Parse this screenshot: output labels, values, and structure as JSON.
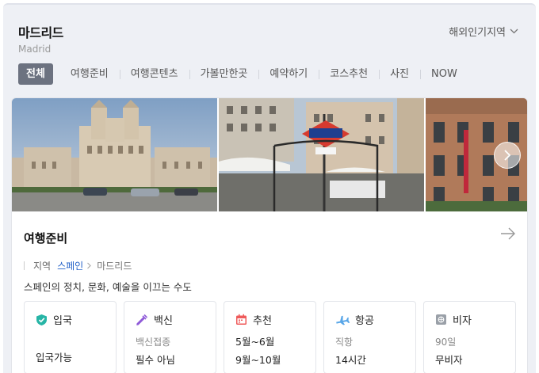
{
  "header": {
    "title": "마드리드",
    "subtitle": "Madrid",
    "region_label": "해외인기지역"
  },
  "tabs": [
    {
      "label": "전체",
      "active": true
    },
    {
      "label": "여행준비"
    },
    {
      "label": "여행콘텐츠"
    },
    {
      "label": "가볼만한곳"
    },
    {
      "label": "예약하기"
    },
    {
      "label": "코스추천"
    },
    {
      "label": "사진"
    },
    {
      "label": "NOW"
    }
  ],
  "section": {
    "title": "여행준비",
    "breadcrumb": {
      "label": "지역",
      "country": "스페인",
      "city": "마드리드"
    },
    "description": "스페인의 정치, 문화, 예술을 이끄는 수도"
  },
  "info_cards": {
    "entry": {
      "title": "입국",
      "line1": "",
      "line2": "입국가능",
      "icon": "shield-check-icon",
      "color": "#27b5a6"
    },
    "vaccine": {
      "title": "백신",
      "line1": "백신접종",
      "line2": "필수 아님",
      "icon": "syringe-icon",
      "color": "#8f5ad8"
    },
    "recommend": {
      "title": "추천",
      "line1": "5월~6월",
      "line2": "9월~10월",
      "icon": "calendar-icon",
      "color": "#ef5a5a"
    },
    "flight": {
      "title": "항공",
      "line1": "직항",
      "line2": "14시간",
      "icon": "airplane-icon",
      "color": "#5aa7e8"
    },
    "visa": {
      "title": "비자",
      "line1": "90일",
      "line2": "무비자",
      "icon": "visa-icon",
      "color": "#9aa0a8"
    }
  },
  "colors": {
    "active_tab": "#6c7280",
    "link": "#2563c9",
    "panel_bg": "#eef0f5"
  }
}
